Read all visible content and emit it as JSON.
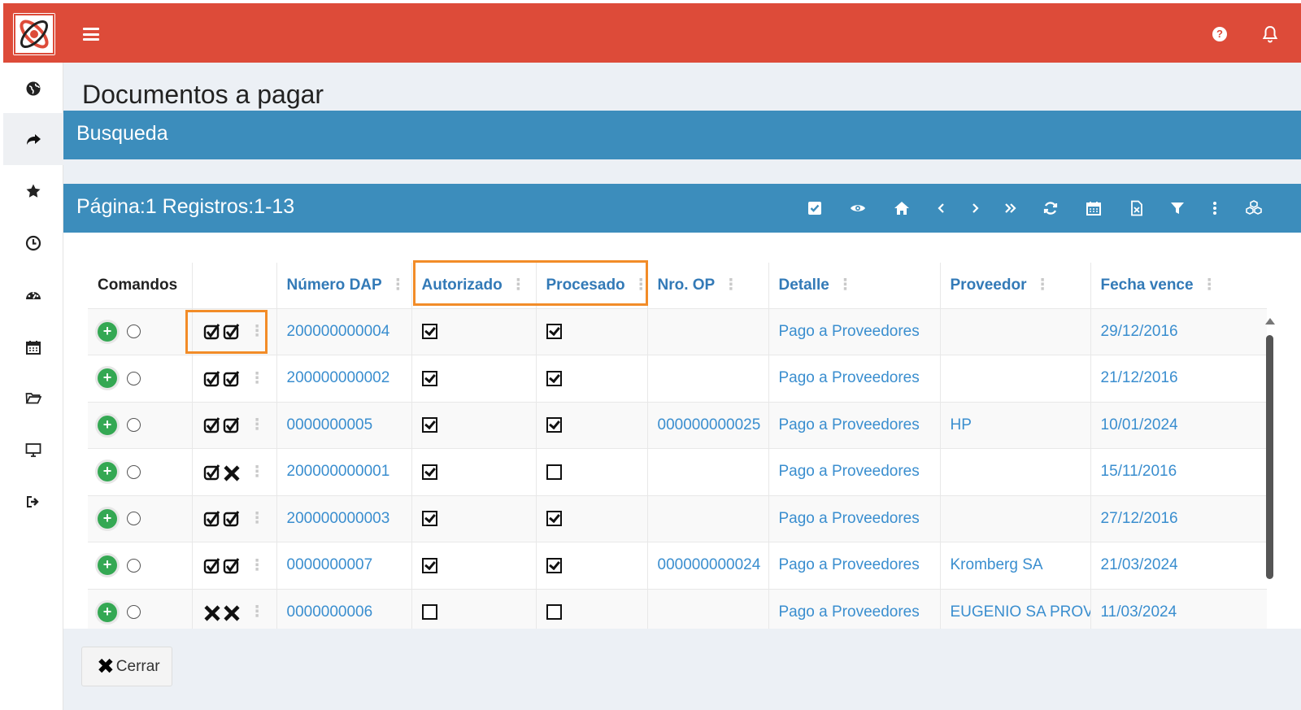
{
  "header": {
    "logo": "app-logo",
    "menu_icon": "hamburger-icon",
    "help_icon": "question-circle-icon",
    "notifications_icon": "bell-icon",
    "brand_color": "#dd4b39"
  },
  "sidebar": {
    "items": [
      {
        "icon": "globe-icon"
      },
      {
        "icon": "share-arrow-icon",
        "active": true
      },
      {
        "icon": "star-icon"
      },
      {
        "icon": "clock-icon"
      },
      {
        "icon": "dashboard-icon"
      },
      {
        "icon": "calendar-icon"
      },
      {
        "icon": "folder-open-icon"
      },
      {
        "icon": "monitor-icon"
      },
      {
        "icon": "sign-out-icon"
      }
    ]
  },
  "page": {
    "title": "Documentos a pagar",
    "search_panel_title": "Busqueda",
    "results_panel_title": "Página:1 Registros:1-13",
    "accent_color": "#3c8dbc"
  },
  "toolbar": [
    {
      "icon": "check-square-icon"
    },
    {
      "icon": "eye-icon"
    },
    {
      "icon": "home-icon"
    },
    {
      "icon": "chevron-left-icon"
    },
    {
      "icon": "chevron-right-icon"
    },
    {
      "icon": "double-chevron-right-icon"
    },
    {
      "icon": "refresh-icon"
    },
    {
      "icon": "calendar-icon"
    },
    {
      "icon": "excel-file-icon"
    },
    {
      "icon": "filter-icon"
    },
    {
      "icon": "vertical-dots-icon"
    },
    {
      "icon": "cubes-icon"
    }
  ],
  "table": {
    "columns": [
      "Comandos",
      "",
      "Número DAP",
      "Autorizado",
      "Procesado",
      "Nro. OP",
      "Detalle",
      "Proveedor",
      "Fecha vence"
    ],
    "rows": [
      {
        "marks": "check-check",
        "dap": "200000000004",
        "autorizado": true,
        "procesado": true,
        "op": "",
        "detalle": "Pago a Proveedores",
        "proveedor": "",
        "fecha": "29/12/2016"
      },
      {
        "marks": "check-check",
        "dap": "200000000002",
        "autorizado": true,
        "procesado": true,
        "op": "",
        "detalle": "Pago a Proveedores",
        "proveedor": "",
        "fecha": "21/12/2016"
      },
      {
        "marks": "check-check",
        "dap": "0000000005",
        "autorizado": true,
        "procesado": true,
        "op": "000000000025",
        "detalle": "Pago a Proveedores",
        "proveedor": "HP",
        "fecha": "10/01/2024"
      },
      {
        "marks": "check-x",
        "dap": "200000000001",
        "autorizado": true,
        "procesado": false,
        "op": "",
        "detalle": "Pago a Proveedores",
        "proveedor": "",
        "fecha": "15/11/2016"
      },
      {
        "marks": "check-check",
        "dap": "200000000003",
        "autorizado": true,
        "procesado": true,
        "op": "",
        "detalle": "Pago a Proveedores",
        "proveedor": "",
        "fecha": "27/12/2016"
      },
      {
        "marks": "check-check",
        "dap": "0000000007",
        "autorizado": true,
        "procesado": true,
        "op": "000000000024",
        "detalle": "Pago a Proveedores",
        "proveedor": "Kromberg SA",
        "fecha": "21/03/2024"
      },
      {
        "marks": "x-x",
        "dap": "0000000006",
        "autorizado": false,
        "procesado": false,
        "op": "",
        "detalle": "Pago a Proveedores",
        "proveedor": "EUGENIO SA PROV",
        "fecha": "11/03/2024"
      }
    ]
  },
  "footer": {
    "close_label": "Cerrar"
  },
  "highlight_color": "#f28c28"
}
